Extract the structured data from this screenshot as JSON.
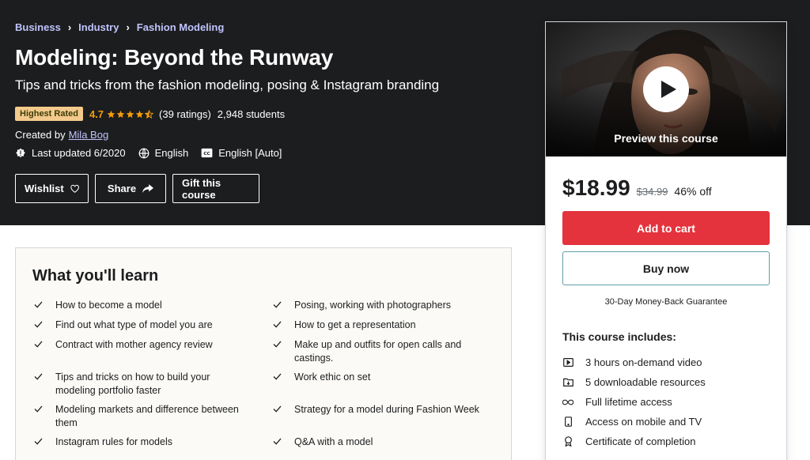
{
  "breadcrumb": [
    "Business",
    "Industry",
    "Fashion Modeling"
  ],
  "course": {
    "title": "Modeling: Beyond the Runway",
    "subtitle": "Tips and tricks from the fashion modeling, posing & Instagram branding",
    "badge": "Highest Rated",
    "rating": "4.7",
    "rating_value": 4.7,
    "ratings_text": "(39 ratings)",
    "students": "2,948 students",
    "created_by_label": "Created by",
    "instructor": "Mila Bog",
    "last_updated": "Last updated 6/2020",
    "language": "English",
    "captions": "English [Auto]"
  },
  "header_buttons": {
    "wishlist": "Wishlist",
    "share": "Share",
    "gift": "Gift this course"
  },
  "sidebar": {
    "preview_label": "Preview this course",
    "price": "$18.99",
    "original_price": "$34.99",
    "discount": "46% off",
    "add_to_cart": "Add to cart",
    "buy_now": "Buy now",
    "guarantee": "30-Day Money-Back Guarantee",
    "includes_title": "This course includes:",
    "includes": [
      {
        "icon": "video-icon",
        "text": "3 hours on-demand video"
      },
      {
        "icon": "folder-download-icon",
        "text": "5 downloadable resources"
      },
      {
        "icon": "infinity-icon",
        "text": "Full lifetime access"
      },
      {
        "icon": "mobile-icon",
        "text": "Access on mobile and TV"
      },
      {
        "icon": "certificate-icon",
        "text": "Certificate of completion"
      }
    ]
  },
  "learn": {
    "title": "What you'll learn",
    "left": [
      "How to become a model",
      "Find out what type of model you are",
      "Contract with mother agency review",
      "Tips and tricks on how to build your modeling portfolio faster",
      "Modeling markets and difference between them",
      "Instagram rules for models"
    ],
    "right": [
      "Posing, working with photographers",
      "How to get a representation",
      "Make up and outfits for open calls and castings.",
      "Work ethic on set",
      "Strategy for a model during Fashion Week",
      "Q&A with a model"
    ]
  },
  "colors": {
    "header_bg": "#1c1d1f",
    "breadcrumb": "#c0c4fc",
    "badge_bg": "#f3ca8c",
    "star": "#f69c08",
    "cart_button": "#e4333d",
    "buy_border": "#5f9ea8"
  }
}
